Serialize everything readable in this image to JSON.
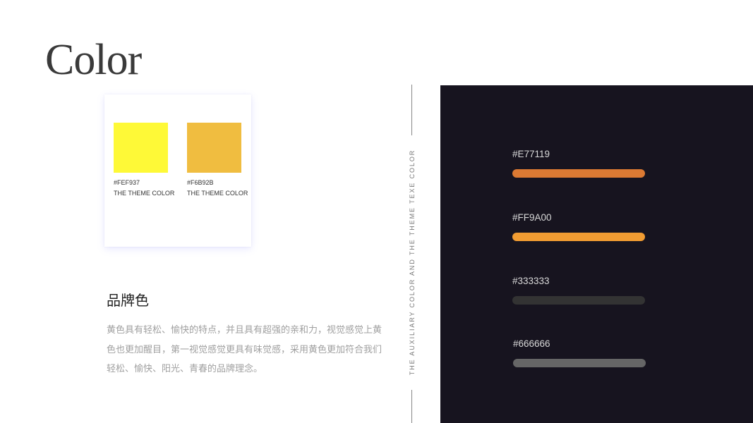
{
  "page": {
    "title": "Color"
  },
  "theme_colors": [
    {
      "hex": "#FEF937",
      "label": "THE THEME COLOR",
      "color": "#FEF937"
    },
    {
      "hex": "#F6B92B",
      "label": "THE THEME COLOR",
      "color": "#F0BD40"
    }
  ],
  "brand": {
    "heading": "品牌色",
    "description": "黄色具有轻松、愉快的特点，并且具有超强的亲和力，视觉感觉上黄色也更加醒目，第一视觉感觉更具有味觉感，采用黄色更加符合我们轻松、愉快、阳光、青春的品牌理念。"
  },
  "vertical_caption": "THE AUXILIARY COLOR AND THE THEME TEXE COLOR",
  "auxiliary_colors": [
    {
      "hex": "#E77119",
      "color": "#DC7A33"
    },
    {
      "hex": "#FF9A00",
      "color": "#F19C32"
    },
    {
      "hex": "#333333",
      "color": "#333333"
    },
    {
      "hex": "#666666",
      "color": "#666666"
    }
  ],
  "panel_background": "#17141F"
}
